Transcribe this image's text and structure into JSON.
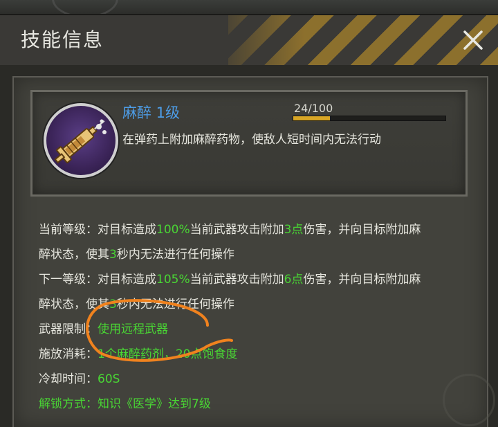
{
  "header": {
    "title": "技能信息"
  },
  "skill": {
    "name": "麻醉 1级",
    "progress_text": "24/100",
    "progress_fraction": 0.24,
    "description": "在弹药上附加麻醉药物，使敌人短时间内无法行动"
  },
  "details": {
    "current_level": {
      "line1_a": "当前等级：对目标造成",
      "line1_b": "100%",
      "line1_c": "当前武器攻击附加",
      "line1_d": "3点",
      "line1_e": "伤害，并向目标附加麻",
      "line2_a": "醉状态，使其",
      "line2_b": "3",
      "line2_c": "秒内无法进行任何操作"
    },
    "next_level": {
      "line1_a": "下一等级：对目标造成",
      "line1_b": "105%",
      "line1_c": "当前武器攻击附加",
      "line1_d": "6点",
      "line1_e": "伤害，并向目标附加麻",
      "line2_a": "醉状态，使其",
      "line2_b": "3",
      "line2_c": "秒内无法进行任何操作"
    },
    "weapon_limit_label": "武器限制：",
    "weapon_limit_value": "使用远程武器",
    "cost_label": "施放消耗：",
    "cost_value": "1个麻醉药剂，20点饱食度",
    "cooldown_label": "冷却时间：",
    "cooldown_value": "60S",
    "unlock": "解锁方式：知识《医学》达到7级"
  },
  "colors": {
    "accent_blue": "#4d9ce6",
    "highlight_green": "#49d634",
    "progress_gold": "#d8a626",
    "annotation_orange": "#f0821e"
  },
  "icons": {
    "close": "close-icon",
    "skill": "syringe-icon"
  }
}
